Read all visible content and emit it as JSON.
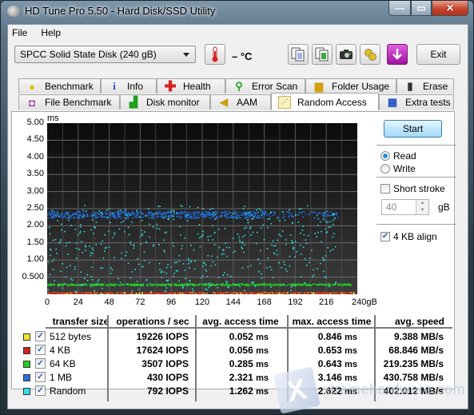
{
  "window": {
    "title": "HD Tune Pro 5.50 - Hard Disk/SSD Utility",
    "controls": {
      "minimize": "—",
      "maximize": "▭",
      "close": "✕"
    }
  },
  "menu": {
    "items": [
      "File",
      "Help"
    ]
  },
  "toolbar": {
    "drive": "SPCC Solid State Disk (240 gB)",
    "temperature": "– °C",
    "icons": [
      "copy-text-icon",
      "copy-screenshot-icon",
      "camera-icon",
      "options-icon",
      "save-icon"
    ],
    "exit_label": "Exit"
  },
  "tabs": {
    "row1": [
      {
        "label": "Benchmark",
        "icon": "benchmark-icon"
      },
      {
        "label": "Info",
        "icon": "info-icon"
      },
      {
        "label": "Health",
        "icon": "health-icon"
      },
      {
        "label": "Error Scan",
        "icon": "error-scan-icon"
      },
      {
        "label": "Folder Usage",
        "icon": "folder-icon"
      },
      {
        "label": "Erase",
        "icon": "trash-icon"
      }
    ],
    "row2": [
      {
        "label": "File Benchmark",
        "icon": "file-benchmark-icon"
      },
      {
        "label": "Disk monitor",
        "icon": "disk-monitor-icon"
      },
      {
        "label": "AAM",
        "icon": "speaker-icon"
      },
      {
        "label": "Random Access",
        "icon": "random-access-icon",
        "active": true
      },
      {
        "label": "Extra tests",
        "icon": "extra-tests-icon"
      }
    ]
  },
  "controls": {
    "start_label": "Start",
    "mode_options": [
      {
        "label": "Read",
        "selected": true
      },
      {
        "label": "Write",
        "selected": false
      }
    ],
    "short_stroke": {
      "label": "Short stroke",
      "checked": false
    },
    "short_stroke_value": "40",
    "short_stroke_unit": "gB",
    "align": {
      "label": "4 KB align",
      "checked": true
    }
  },
  "chart_data": {
    "type": "scatter",
    "title": "",
    "ylabel": "ms",
    "xlabel": "gB",
    "ylim": [
      0,
      5.0
    ],
    "xlim": [
      0,
      240
    ],
    "y_ticks": [
      "5.00",
      "4.50",
      "4.00",
      "3.50",
      "3.00",
      "2.50",
      "2.00",
      "1.50",
      "1.00",
      "0.500"
    ],
    "x_ticks": [
      "0",
      "24",
      "48",
      "72",
      "96",
      "120",
      "144",
      "168",
      "192",
      "216",
      "240gB"
    ],
    "grid": true,
    "series": [
      {
        "name": "512 bytes",
        "color": "#f0e020",
        "avg_ms": 0.052,
        "max_ms": 0.846
      },
      {
        "name": "4 KB",
        "color": "#d02020",
        "avg_ms": 0.056,
        "max_ms": 0.653
      },
      {
        "name": "64 KB",
        "color": "#20d020",
        "avg_ms": 0.285,
        "max_ms": 0.643
      },
      {
        "name": "1 MB",
        "color": "#2070e0",
        "avg_ms": 2.321,
        "max_ms": 3.146
      },
      {
        "name": "Random",
        "color": "#30e0e0",
        "avg_ms": 1.262,
        "max_ms": 2.622
      }
    ]
  },
  "results": {
    "headers": [
      "transfer size",
      "operations / sec",
      "avg. access time",
      "max. access time",
      "avg. speed"
    ],
    "rows": [
      {
        "label": "512 bytes",
        "color": "#f5e42a",
        "checked": true,
        "ops": "19226 IOPS",
        "avg": "0.052",
        "max": "0.846",
        "ms": "ms",
        "speed": "9.388 MB/s"
      },
      {
        "label": "4 KB",
        "color": "#d42020",
        "checked": true,
        "ops": "17624 IOPS",
        "avg": "0.056",
        "max": "0.653",
        "ms": "ms",
        "speed": "68.846 MB/s"
      },
      {
        "label": "64 KB",
        "color": "#22d022",
        "checked": true,
        "ops": "3507 IOPS",
        "avg": "0.285",
        "max": "0.643",
        "ms": "ms",
        "speed": "219.235 MB/s"
      },
      {
        "label": "1 MB",
        "color": "#2a6fd8",
        "checked": true,
        "ops": "430 IOPS",
        "avg": "2.321",
        "max": "3.146",
        "ms": "ms",
        "speed": "430.758 MB/s"
      },
      {
        "label": "Random",
        "color": "#2fe0e8",
        "checked": true,
        "ops": "792 IOPS",
        "avg": "1.262",
        "max": "2.622",
        "ms": "ms",
        "speed": "402.012 MB/s"
      }
    ]
  },
  "watermark": {
    "text": "xtremehardware.com"
  }
}
